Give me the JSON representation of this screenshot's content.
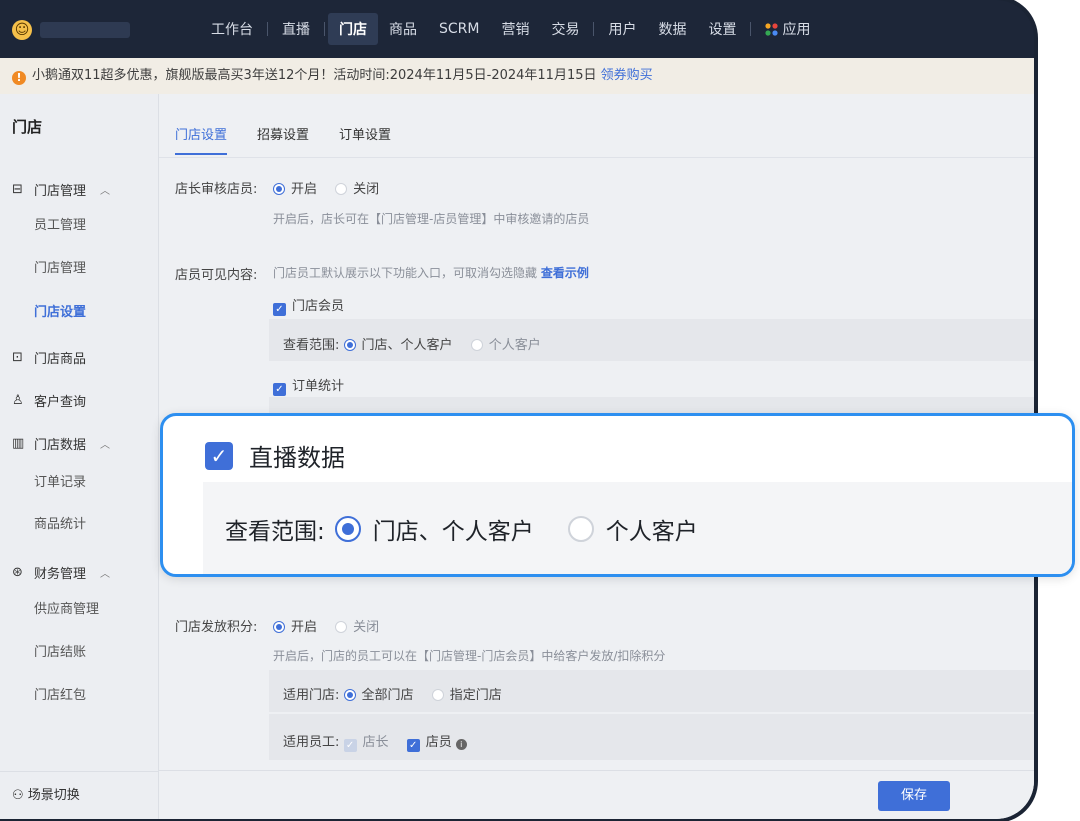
{
  "nav": {
    "items": [
      {
        "label": "工作台"
      },
      {
        "label": "直播"
      },
      {
        "label": "门店",
        "active": true
      },
      {
        "label": "商品"
      },
      {
        "label": "SCRM"
      },
      {
        "label": "营销"
      },
      {
        "label": "交易"
      },
      {
        "label": "用户"
      },
      {
        "label": "数据"
      },
      {
        "label": "设置"
      },
      {
        "label": "应用"
      }
    ]
  },
  "banner": {
    "text": "小鹅通双11超多优惠，旗舰版最高买3年送12个月！活动时间:2024年11月5日-2024年11月15日",
    "link": "领券购买"
  },
  "sidebar": {
    "title": "门店",
    "groups": [
      {
        "label": "门店管理",
        "items": [
          "员工管理",
          "门店管理",
          "门店设置"
        ]
      },
      {
        "label": "门店商品"
      },
      {
        "label": "客户查询"
      },
      {
        "label": "门店数据",
        "items": [
          "订单记录",
          "商品统计"
        ]
      },
      {
        "label": "财务管理",
        "items": [
          "供应商管理",
          "门店结账",
          "门店红包"
        ]
      }
    ],
    "active_item": "门店设置",
    "bottom": "场景切换"
  },
  "tabs": [
    "门店设置",
    "招募设置",
    "订单设置"
  ],
  "form": {
    "audit": {
      "label": "店长审核店员:",
      "on": "开启",
      "off": "关闭",
      "hint": "开启后，店长可在【门店管理-店员管理】中审核邀请的店员"
    },
    "visible": {
      "label": "店员可见内容:",
      "hint": "门店员工默认展示以下功能入口，可取消勾选隐藏",
      "link": "查看示例",
      "member": "门店会员",
      "scope_label": "查看范围:",
      "scope_opt1": "门店、个人客户",
      "scope_opt2": "个人客户",
      "order_stats": "订单统计"
    },
    "points": {
      "label": "门店发放积分:",
      "on": "开启",
      "off": "关闭",
      "hint": "开启后，门店的员工可以在【门店管理-门店会员】中给客户发放/扣除积分",
      "store_label": "适用门店:",
      "store_all": "全部门店",
      "store_some": "指定门店",
      "staff_label": "适用员工:",
      "staff_manager": "店长",
      "staff_clerk": "店员"
    }
  },
  "save_label": "保存",
  "zoom": {
    "title": "直播数据",
    "scope_label": "查看范围:",
    "opt1": "门店、个人客户",
    "opt2": "个人客户"
  },
  "colors": {
    "accent": "#3f6fd8",
    "callout_border": "#2d8ff0",
    "nav_bg": "#1d2638"
  }
}
